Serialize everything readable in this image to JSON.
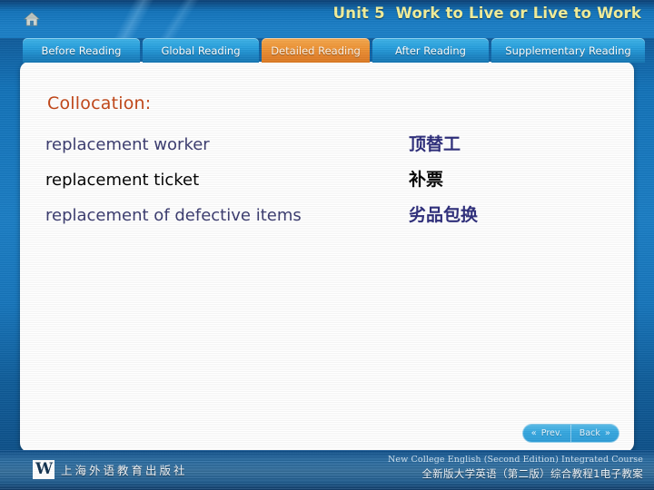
{
  "header": {
    "home_icon": "home-icon",
    "unit_title": "Unit 5  Work to Live or Live to Work"
  },
  "tabs": [
    {
      "label": "Before Reading",
      "active": false
    },
    {
      "label": "Global Reading",
      "active": false
    },
    {
      "label": "Detailed Reading",
      "active": true
    },
    {
      "label": "After Reading",
      "active": false
    },
    {
      "label": "Supplementary Reading",
      "active": false
    }
  ],
  "main": {
    "heading": "Collocation:",
    "entries": [
      {
        "english": "replacement worker",
        "chinese": "顶替工",
        "emphasis": false
      },
      {
        "english": "replacement ticket",
        "chinese": "补票",
        "emphasis": true
      },
      {
        "english": "replacement of defective items",
        "chinese": "劣品包换",
        "emphasis": false
      }
    ]
  },
  "navigation": {
    "prev_label": "Prev.",
    "prev_icon": "chevron-double-left-icon",
    "next_label": "Back",
    "next_icon": "chevron-double-right-icon"
  },
  "footer": {
    "publisher_mark": "W",
    "publisher_name": "上海外语教育出版社",
    "course_en": "New College English (Second Edition) Integrated Course",
    "course_zh": "全新版大学英语（第二版）综合教程1电子教案"
  },
  "colors": {
    "accent_orange": "#e4822a",
    "heading_orange": "#c24516",
    "title_yellow": "#f2ef9a",
    "tab_blue": "#27a0de",
    "body_navy": "#393a6e",
    "panel_white": "#ffffff"
  }
}
